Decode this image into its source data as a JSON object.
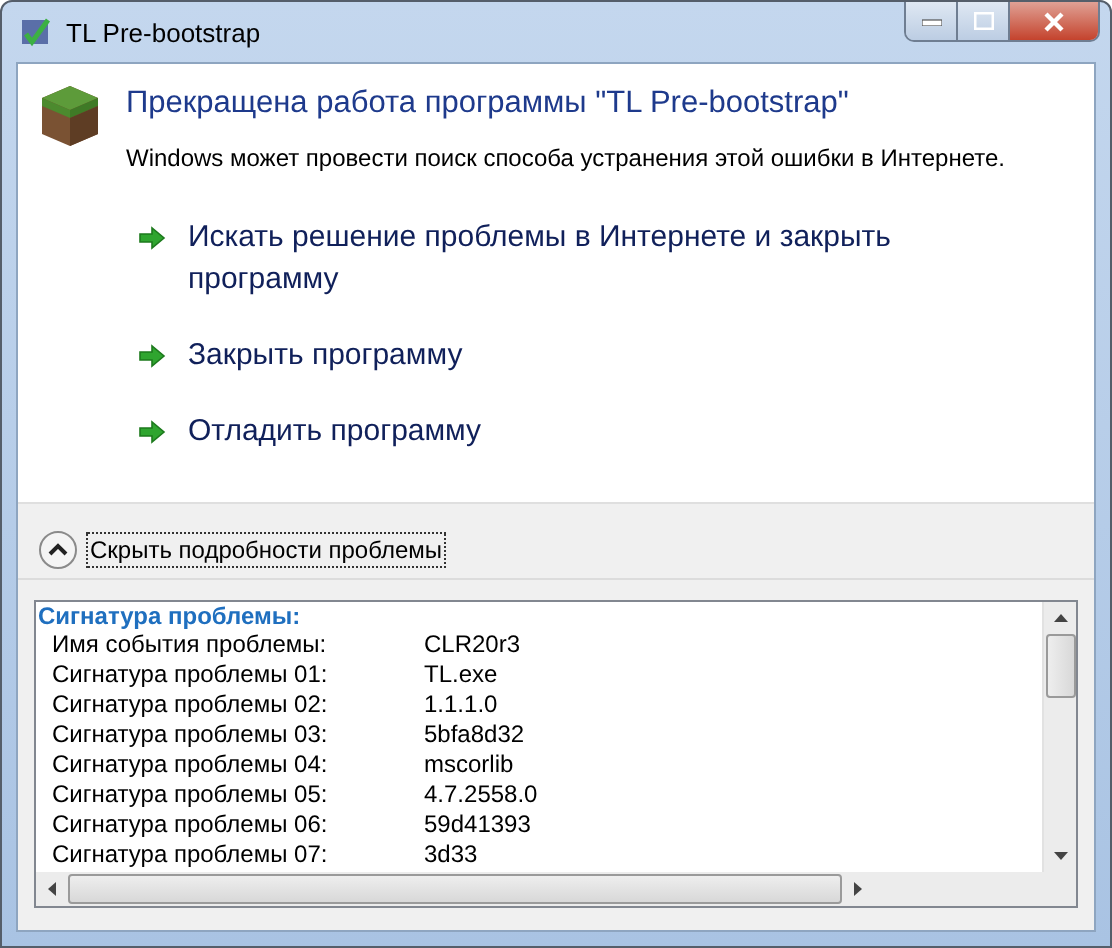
{
  "window": {
    "title": "TL Pre-bootstrap"
  },
  "heading": "Прекращена работа программы \"TL Pre-bootstrap\"",
  "message": "Windows может провести поиск способа устранения этой ошибки в Интернете.",
  "actions": [
    {
      "label": "Искать решение проблемы в Интернете и закрыть программу"
    },
    {
      "label": "Закрыть программу"
    },
    {
      "label": "Отладить программу"
    }
  ],
  "details_toggle": {
    "label": "Скрыть подробности проблемы",
    "expanded": true
  },
  "details": {
    "heading": "Сигнатура проблемы:",
    "rows": [
      {
        "key": "Имя события проблемы:",
        "value": "CLR20r3"
      },
      {
        "key": "Сигнатура проблемы 01:",
        "value": "TL.exe"
      },
      {
        "key": "Сигнатура проблемы 02:",
        "value": "1.1.1.0"
      },
      {
        "key": "Сигнатура проблемы 03:",
        "value": "5bfa8d32"
      },
      {
        "key": "Сигнатура проблемы 04:",
        "value": "mscorlib"
      },
      {
        "key": "Сигнатура проблемы 05:",
        "value": "4.7.2558.0"
      },
      {
        "key": "Сигнатура проблемы 06:",
        "value": "59d41393"
      },
      {
        "key": "Сигнатура проблемы 07:",
        "value": "3d33"
      }
    ]
  }
}
